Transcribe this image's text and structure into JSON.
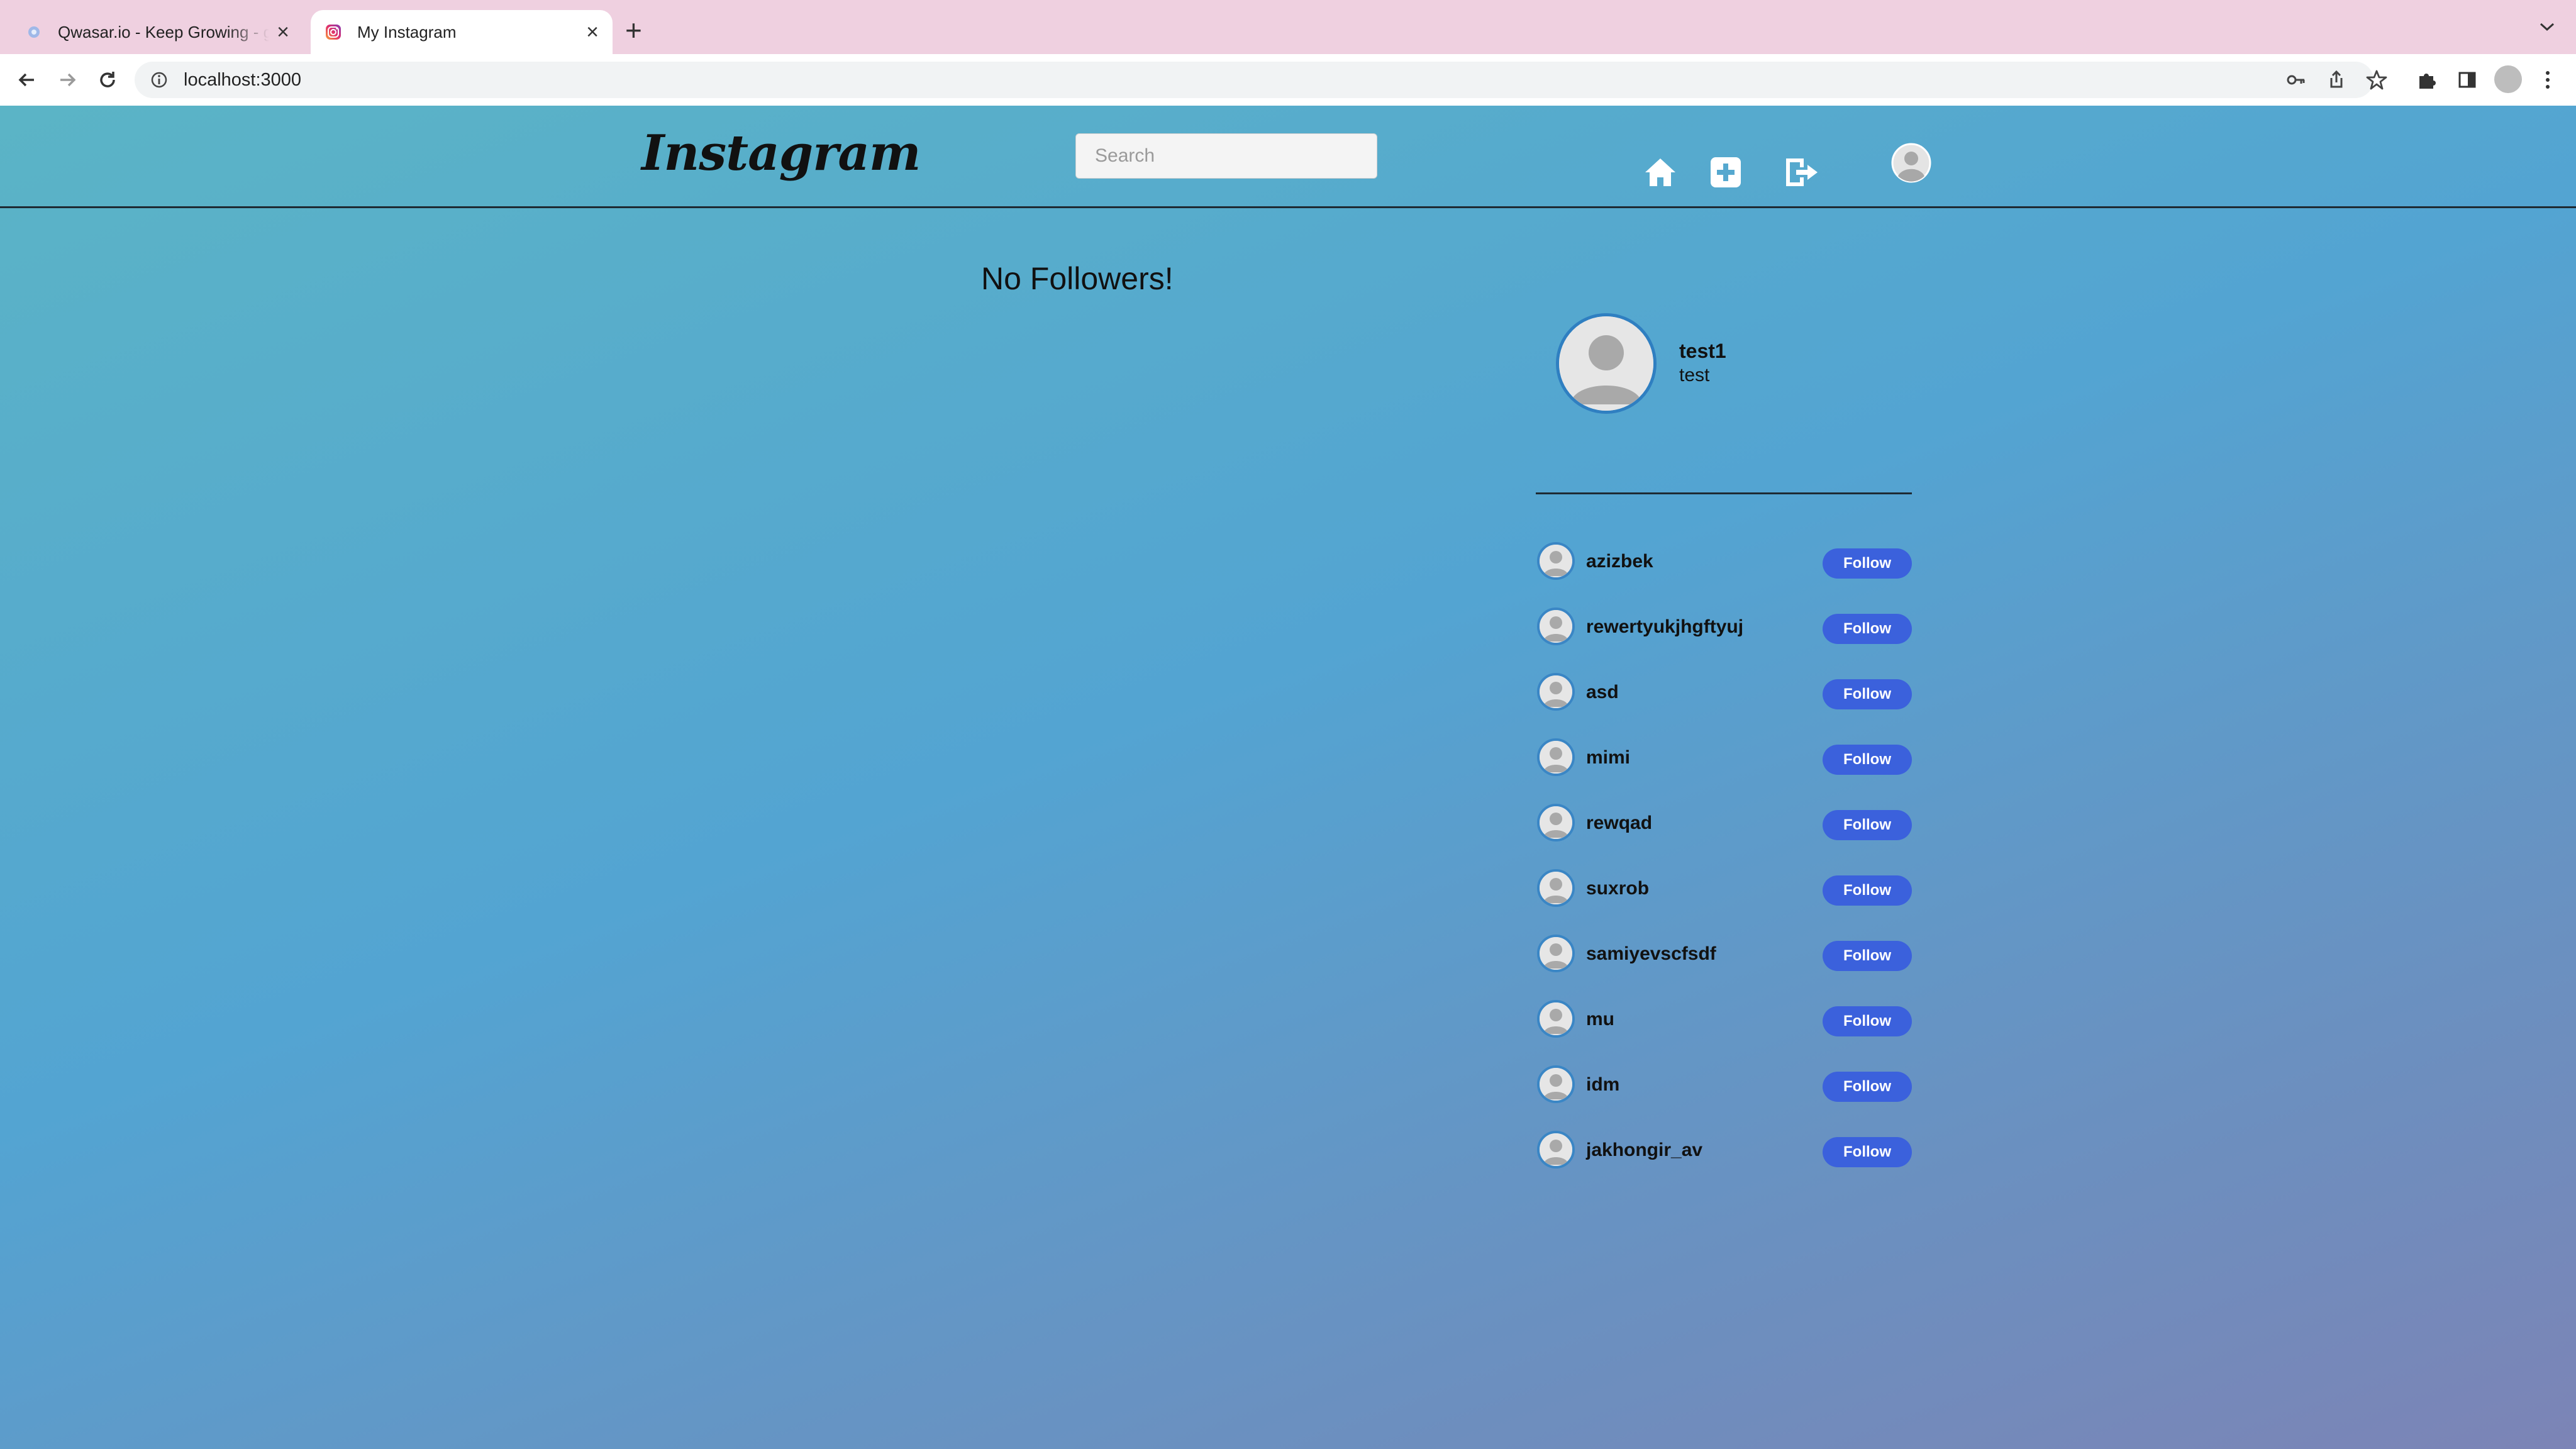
{
  "browser": {
    "tabs": [
      {
        "title": "Qwasar.io - Keep Growing - gu",
        "active": false
      },
      {
        "title": "My Instagram",
        "active": true
      }
    ],
    "url": "localhost:3000"
  },
  "header": {
    "logo": "Instagram",
    "search_placeholder": "Search"
  },
  "main": {
    "empty_message": "No Followers!"
  },
  "profile": {
    "username": "test1",
    "full_name": "test"
  },
  "suggestions": [
    {
      "username": "azizbek",
      "action": "Follow"
    },
    {
      "username": "rewertyukjhgftyuj",
      "action": "Follow"
    },
    {
      "username": "asd",
      "action": "Follow"
    },
    {
      "username": "mimi",
      "action": "Follow"
    },
    {
      "username": "rewqad",
      "action": "Follow"
    },
    {
      "username": "suxrob",
      "action": "Follow"
    },
    {
      "username": "samiyevscfsdf",
      "action": "Follow"
    },
    {
      "username": "mu",
      "action": "Follow"
    },
    {
      "username": "idm",
      "action": "Follow"
    },
    {
      "username": "jakhongir_av",
      "action": "Follow"
    }
  ],
  "colors": {
    "follow_button": "#3b61dc",
    "tab_strip": "#efd0e0",
    "page_gradient_start": "#5bb4c6",
    "page_gradient_end": "#7c84b6"
  },
  "icons": [
    "home-icon",
    "add-post-icon",
    "logout-icon",
    "profile-avatar-icon",
    "puzzle-icon",
    "bookmark-star-icon",
    "key-icon",
    "share-icon",
    "side-panel-icon"
  ]
}
